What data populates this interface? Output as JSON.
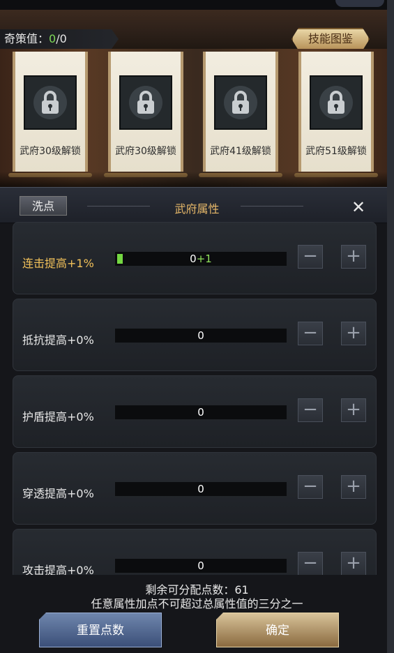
{
  "header": {
    "strategy_label": "奇策值：",
    "strategy_value": "0",
    "strategy_total": "/0",
    "skill_button": "技能图鉴"
  },
  "scrolls": [
    {
      "label": "武府30级解锁",
      "icon": "lock-icon"
    },
    {
      "label": "武府30级解锁",
      "icon": "lock-icon"
    },
    {
      "label": "武府41级解锁",
      "icon": "lock-icon"
    },
    {
      "label": "武府51级解锁",
      "icon": "lock-icon"
    }
  ],
  "panel": {
    "wash_button": "洗点",
    "title": "武府属性",
    "close_icon": "close-icon"
  },
  "attributes": [
    {
      "label": "连击提高+1%",
      "value": "0",
      "pending": "+1",
      "active": true
    },
    {
      "label": "抵抗提高+0%",
      "value": "0",
      "pending": ""
    },
    {
      "label": "护盾提高+0%",
      "value": "0",
      "pending": ""
    },
    {
      "label": "穿透提高+0%",
      "value": "0",
      "pending": ""
    },
    {
      "label": "攻击提高+0%",
      "value": "0",
      "pending": ""
    }
  ],
  "footer": {
    "remaining": "剩余可分配点数：61",
    "rule": "任意属性加点不可超过总属性值的三分之一",
    "reset_button": "重置点数",
    "confirm_button": "确定"
  },
  "colors": {
    "accent_gold": "#e7b869",
    "active_label": "#f2c15a",
    "green": "#74d742"
  }
}
